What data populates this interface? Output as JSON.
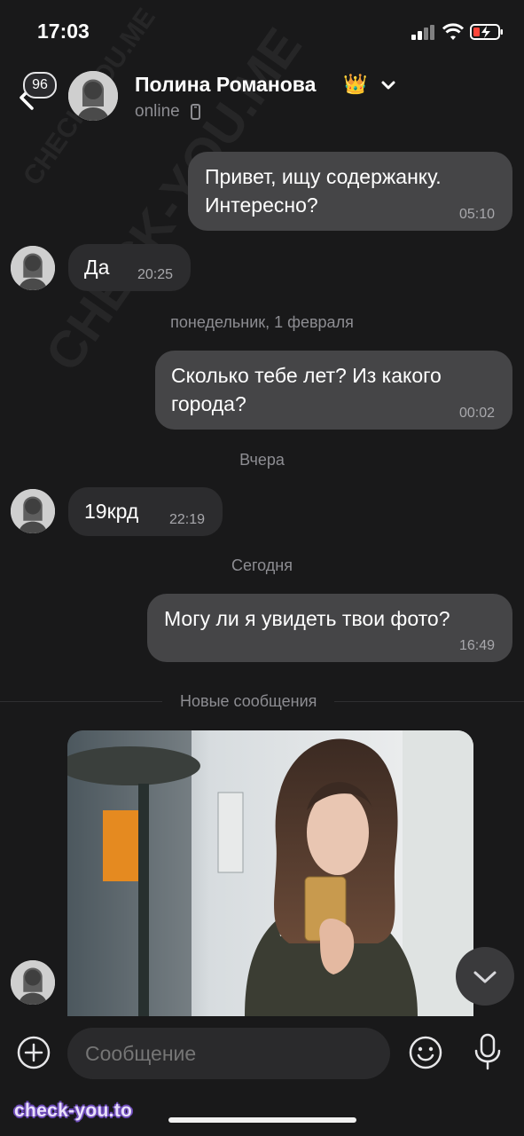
{
  "status_bar": {
    "time": "17:03"
  },
  "header": {
    "unread_count": "96",
    "contact_name": "Полина Романова",
    "crown_emoji": "👑",
    "status": "online"
  },
  "messages": [
    {
      "direction": "out",
      "text": "Привет, ищу содержанку.\nИнтересно?",
      "time": "05:10"
    },
    {
      "direction": "in",
      "text": "Да",
      "time": "20:25"
    },
    {
      "type": "date",
      "text": "понедельник, 1 февраля"
    },
    {
      "direction": "out",
      "text": "Сколько тебе лет? Из какого\nгорода?",
      "time": "00:02"
    },
    {
      "type": "date",
      "text": "Вчера"
    },
    {
      "direction": "in",
      "text": "19крд",
      "time": "22:19"
    },
    {
      "type": "date",
      "text": "Сегодня"
    },
    {
      "direction": "out",
      "text": "Могу ли я увидеть твои фото?",
      "time": "16:49"
    }
  ],
  "new_messages_label": "Новые сообщения",
  "composer": {
    "placeholder": "Сообщение"
  },
  "watermarks": {
    "bottom": "check-you.to",
    "diagonal": "CHECK-YOU.ME"
  },
  "colors": {
    "background": "#19191a",
    "out_bubble": "#454547",
    "in_bubble": "#2c2c2e",
    "accent": "#ffffff"
  }
}
